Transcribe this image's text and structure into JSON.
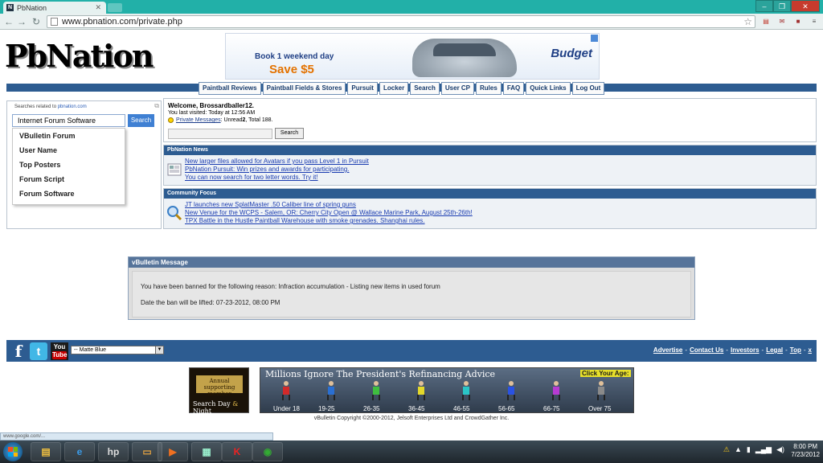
{
  "browser": {
    "tab_title": "PbNation",
    "tab_favicon": "N",
    "url": "www.pbnation.com/private.php",
    "window_controls": [
      "–",
      "❐",
      "✕"
    ]
  },
  "ads": {
    "top": {
      "line1": "Book 1 weekend day",
      "line2": "Save $5",
      "brand": "Budget"
    },
    "supporter": {
      "line1": "Annual supporting member",
      "line2a": "Search Day ",
      "amp": "&",
      "line2b": " Night"
    },
    "refinance": {
      "title": "Millions Ignore The President's Refinancing Advice",
      "click": "Click Your Age:",
      "ages": [
        "Under 18",
        "19-25",
        "26-35",
        "36-45",
        "46-55",
        "56-65",
        "66-75",
        "Over 75"
      ],
      "colors": [
        "#d22a2a",
        "#2a6fd2",
        "#3fbf3f",
        "#e3d82a",
        "#2ac6c6",
        "#2a52e3",
        "#b83bd2",
        "#8a8a8a"
      ]
    }
  },
  "site": {
    "logo": "PbNation",
    "nav": [
      "Paintball Reviews",
      "Paintball Fields & Stores",
      "Pursuit",
      "Locker",
      "Search",
      "User CP",
      "Rules",
      "FAQ",
      "Quick Links",
      "Log Out"
    ]
  },
  "sidebar": {
    "related_label": "Searches related to ",
    "related_site": "pbnation.com",
    "search_value": "Internet Forum Software",
    "search_button": "Search",
    "suggestions": [
      "VBulletin Forum",
      "User Name",
      "Top Posters",
      "Forum Script",
      "Forum Software"
    ]
  },
  "welcome": {
    "line1": "Welcome, Brossardballer12.",
    "line2": "You last visited: Today at 12:56 AM",
    "pm_link": "Private Messages",
    "pm_text": ": Unread ",
    "pm_unread": "2",
    "pm_total_text": ", Total 188.",
    "search_button": "Search"
  },
  "news": {
    "title": "PbNation News",
    "items": [
      "New larger files allowed for Avatars if you pass Level 1 in Pursuit",
      "PbNation Pursuit: Win prizes and awards for participating.",
      "You can now search for two letter words. Try it!"
    ]
  },
  "focus": {
    "title": "Community Focus",
    "items": [
      "JT launches new SplatMaster .50 Caliber line of spring guns",
      "New Venue for the WCPS - Salem, OR: Cherry City Open @ Wallace Marine Park, August 25th-26th!",
      "TPX Battle in the Hustle Paintball Warehouse with smoke grenades. Shanghai rules."
    ]
  },
  "message": {
    "title": "vBulletin Message",
    "line1": "You have been banned for the following reason: Infraction accumulation - Listing new items in used forum",
    "line2": "Date the ban will be lifted: 07-23-2012, 08:00 PM"
  },
  "footer": {
    "style_select": "-- Matte Blue",
    "links": [
      "Advertise",
      "Contact Us",
      "Investors",
      "Legal",
      "Top"
    ],
    "copyright": "vBulletin Copyright ©2000-2012, Jelsoft Enterprises Ltd and CrowdGather Inc."
  },
  "status_bubble": "www.google.com/...",
  "taskbar": {
    "time": "8:00 PM",
    "date": "7/23/2012"
  }
}
